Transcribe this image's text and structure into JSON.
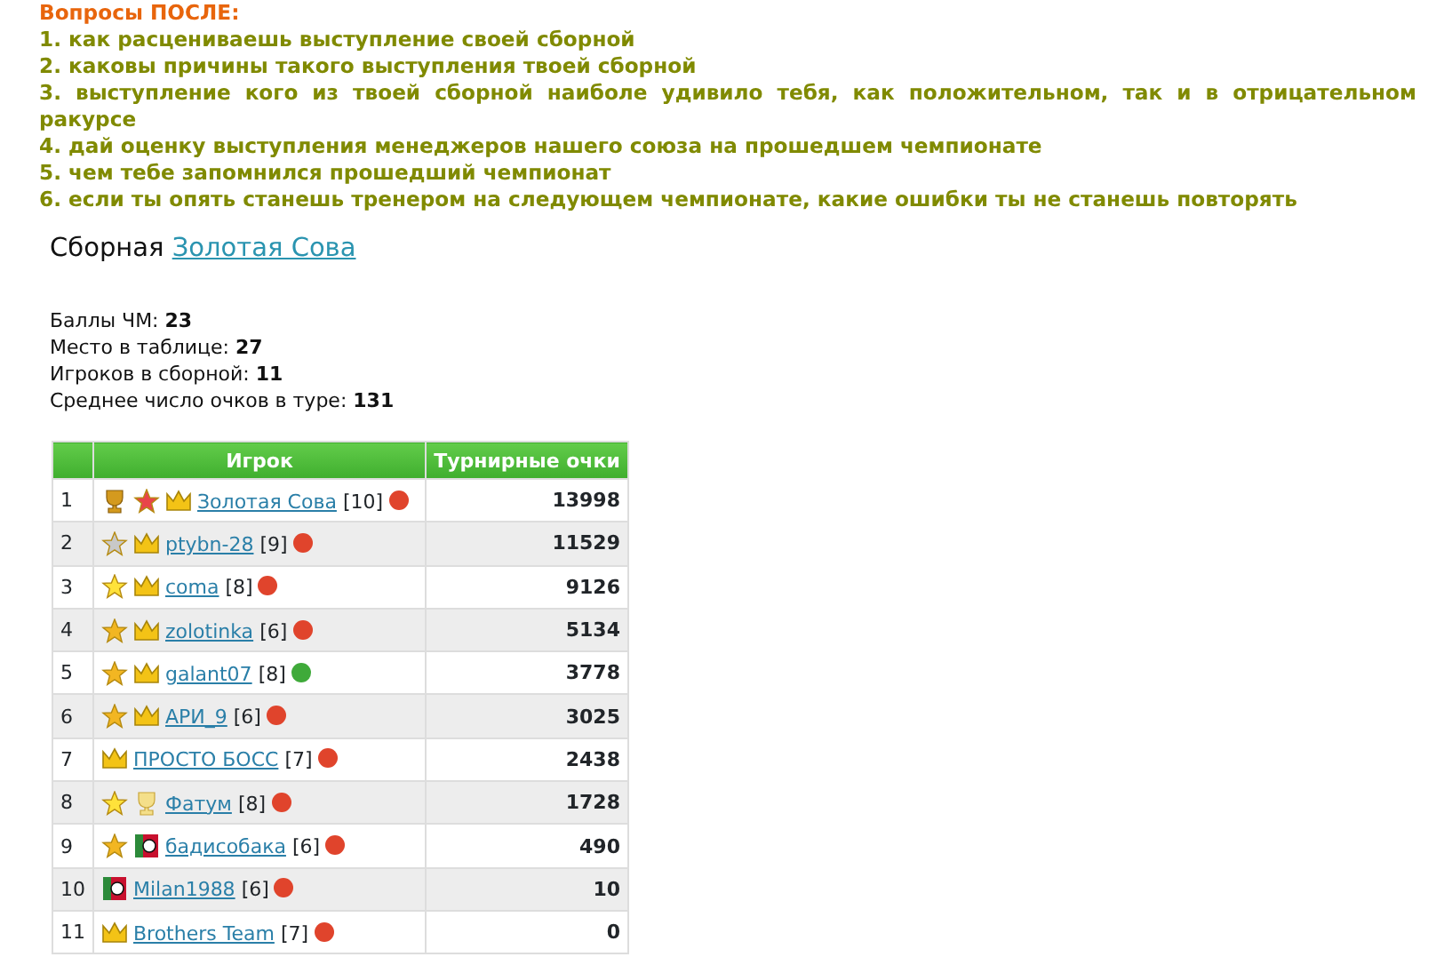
{
  "questions": {
    "title": "Вопросы ПОСЛЕ:",
    "items": [
      "1. как расцениваешь выступление своей сборной",
      "2. каковы причины такого выступления твоей сборной",
      "3. выступление кого из твоей сборной наиболе удивило тебя, как положительном, так и в отрицательном ракурсе",
      "4. дай оценку выступления менеджеров нашего союза на прошедшем чемпионате",
      "5. чем тебе запомнился прошедший чемпионат",
      "6. если ты опять станешь тренером на следующем чемпионате, какие ошибки ты не станешь повторять"
    ]
  },
  "team": {
    "label": "Сборная",
    "name": "Золотая Сова"
  },
  "stats": [
    {
      "label": "Баллы ЧМ:",
      "value": "23"
    },
    {
      "label": "Место в таблице:",
      "value": "27"
    },
    {
      "label": "Игроков в сборной:",
      "value": "11"
    },
    {
      "label": "Среднее число очков в туре:",
      "value": "131"
    }
  ],
  "table": {
    "columns": [
      "Игрок",
      "Турнирные очки"
    ],
    "rows": [
      {
        "rank": "1",
        "badges": [
          {
            "kind": "trophy"
          },
          {
            "kind": "star",
            "color": "#e8454a"
          },
          {
            "kind": "crown"
          }
        ],
        "player": "Золотая Сова",
        "level": "[10]",
        "color": "#e0442c",
        "points": "13998"
      },
      {
        "rank": "2",
        "badges": [
          {
            "kind": "star",
            "color": "#c8c8c8"
          },
          {
            "kind": "crown"
          }
        ],
        "player": "ptybn-28",
        "level": "[9]",
        "color": "#e0442c",
        "points": "11529"
      },
      {
        "rank": "3",
        "badges": [
          {
            "kind": "star",
            "color": "#ffe23a"
          },
          {
            "kind": "crown"
          }
        ],
        "player": "coma",
        "level": "[8]",
        "color": "#e0442c",
        "points": "9126"
      },
      {
        "rank": "4",
        "badges": [
          {
            "kind": "star",
            "color": "#f2b622"
          },
          {
            "kind": "crown"
          }
        ],
        "player": "zolotinka",
        "level": "[6]",
        "color": "#e0442c",
        "points": "5134"
      },
      {
        "rank": "5",
        "badges": [
          {
            "kind": "star",
            "color": "#f2b622"
          },
          {
            "kind": "crown"
          }
        ],
        "player": "galant07",
        "level": "[8]",
        "color": "#3faa3a",
        "points": "3778"
      },
      {
        "rank": "6",
        "badges": [
          {
            "kind": "star",
            "color": "#f2b622"
          },
          {
            "kind": "crown"
          }
        ],
        "player": "АРИ_9",
        "level": "[6]",
        "color": "#e0442c",
        "points": "3025"
      },
      {
        "rank": "7",
        "badges": [
          {
            "kind": "crown"
          }
        ],
        "player": "ПРОСТО БОСС",
        "level": "[7]",
        "color": "#e0442c",
        "points": "2438"
      },
      {
        "rank": "8",
        "badges": [
          {
            "kind": "star",
            "color": "#ffe23a"
          },
          {
            "kind": "cup"
          }
        ],
        "player": "Фатум",
        "level": "[8]",
        "color": "#e0442c",
        "points": "1728"
      },
      {
        "rank": "9",
        "badges": [
          {
            "kind": "star",
            "color": "#f2b622"
          },
          {
            "kind": "club"
          }
        ],
        "player": "бадисобака",
        "level": "[6]",
        "color": "#e0442c",
        "points": "490"
      },
      {
        "rank": "10",
        "badges": [
          {
            "kind": "club"
          }
        ],
        "player": "Milan1988",
        "level": "[6]",
        "color": "#e0442c",
        "points": "10"
      },
      {
        "rank": "11",
        "badges": [
          {
            "kind": "crown"
          }
        ],
        "player": "Brothers Team",
        "level": "[7]",
        "color": "#e0442c",
        "points": "0"
      }
    ]
  }
}
